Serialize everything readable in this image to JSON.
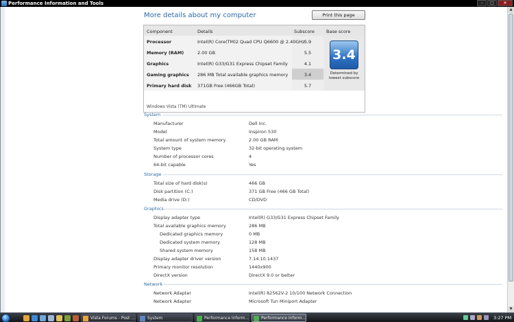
{
  "window": {
    "title": "Performance Information and Tools",
    "minimize": "–",
    "maximize": "□",
    "close": "✕"
  },
  "heading": "More details about my computer",
  "print_button": "Print this page",
  "score_table": {
    "headers": {
      "component": "Component",
      "details": "Details",
      "subscore": "Subscore",
      "base": "Base score"
    },
    "rows": [
      {
        "component": "Processor",
        "details": "Intel(R) Core(TM)2 Quad CPU Q6600 @ 2.40GHz",
        "subscore": "5.9"
      },
      {
        "component": "Memory (RAM)",
        "details": "2.00 GB",
        "subscore": "5.5"
      },
      {
        "component": "Graphics",
        "details": "Intel(R) G33/G31 Express Chipset Family",
        "subscore": "4.1"
      },
      {
        "component": "Gaming graphics",
        "details": "286 MB Total available graphics memory",
        "subscore": "3.4"
      },
      {
        "component": "Primary hard disk",
        "details": "371GB Free (466GB Total)",
        "subscore": "5.7"
      }
    ],
    "base_score": "3.4",
    "base_note": "Determined by lowest subscore",
    "os_name": "Windows Vista (TM) Ultimate"
  },
  "system": {
    "title": "System",
    "items": [
      {
        "label": "Manufacturer",
        "value": "Dell Inc."
      },
      {
        "label": "Model",
        "value": "Inspiron 530"
      },
      {
        "label": "Total amount of system memory",
        "value": "2.00 GB RAM"
      },
      {
        "label": "System type",
        "value": "32-bit operating system"
      },
      {
        "label": "Number of processor cores",
        "value": "4"
      },
      {
        "label": "64-bit capable",
        "value": "Yes"
      }
    ]
  },
  "storage": {
    "title": "Storage",
    "items": [
      {
        "label": "Total size of hard disk(s)",
        "value": "466 GB"
      },
      {
        "label": "Disk partition (C:)",
        "value": "371 GB Free (466 GB Total)"
      },
      {
        "label": "Media drive (D:)",
        "value": "CD/DVD"
      }
    ]
  },
  "graphics": {
    "title": "Graphics",
    "items": [
      {
        "label": "Display adapter type",
        "value": "Intel(R) G33/G31 Express Chipset Family"
      },
      {
        "label": "Total available graphics memory",
        "value": "286 MB"
      },
      {
        "label": "Dedicated graphics memory",
        "value": "0 MB"
      },
      {
        "label": "Dedicated system memory",
        "value": "128 MB"
      },
      {
        "label": "Shared system memory",
        "value": "158 MB"
      },
      {
        "label": "Display adapter driver version",
        "value": "7.14.10.1437"
      },
      {
        "label": "Primary monitor resolution",
        "value": "1440x900"
      },
      {
        "label": "DirectX version",
        "value": "DirectX 9.0 or better"
      }
    ]
  },
  "network": {
    "title": "Network",
    "items": [
      {
        "label": "Network Adapter",
        "value": "Intel(R) 82562V-2 10/100 Network Connection"
      },
      {
        "label": "Network Adapter",
        "value": "Microsoft Tun Miniport Adapter"
      }
    ]
  },
  "taskbar": {
    "tasks": [
      {
        "label": "Vista Forums - Post ..."
      },
      {
        "label": "System"
      },
      {
        "label": "Performance Inform..."
      },
      {
        "label": "Performance Inform..."
      }
    ],
    "clock": "3:27 PM"
  },
  "colors": {
    "accent": "#2b6aa8",
    "badge": "#2d72c4"
  }
}
